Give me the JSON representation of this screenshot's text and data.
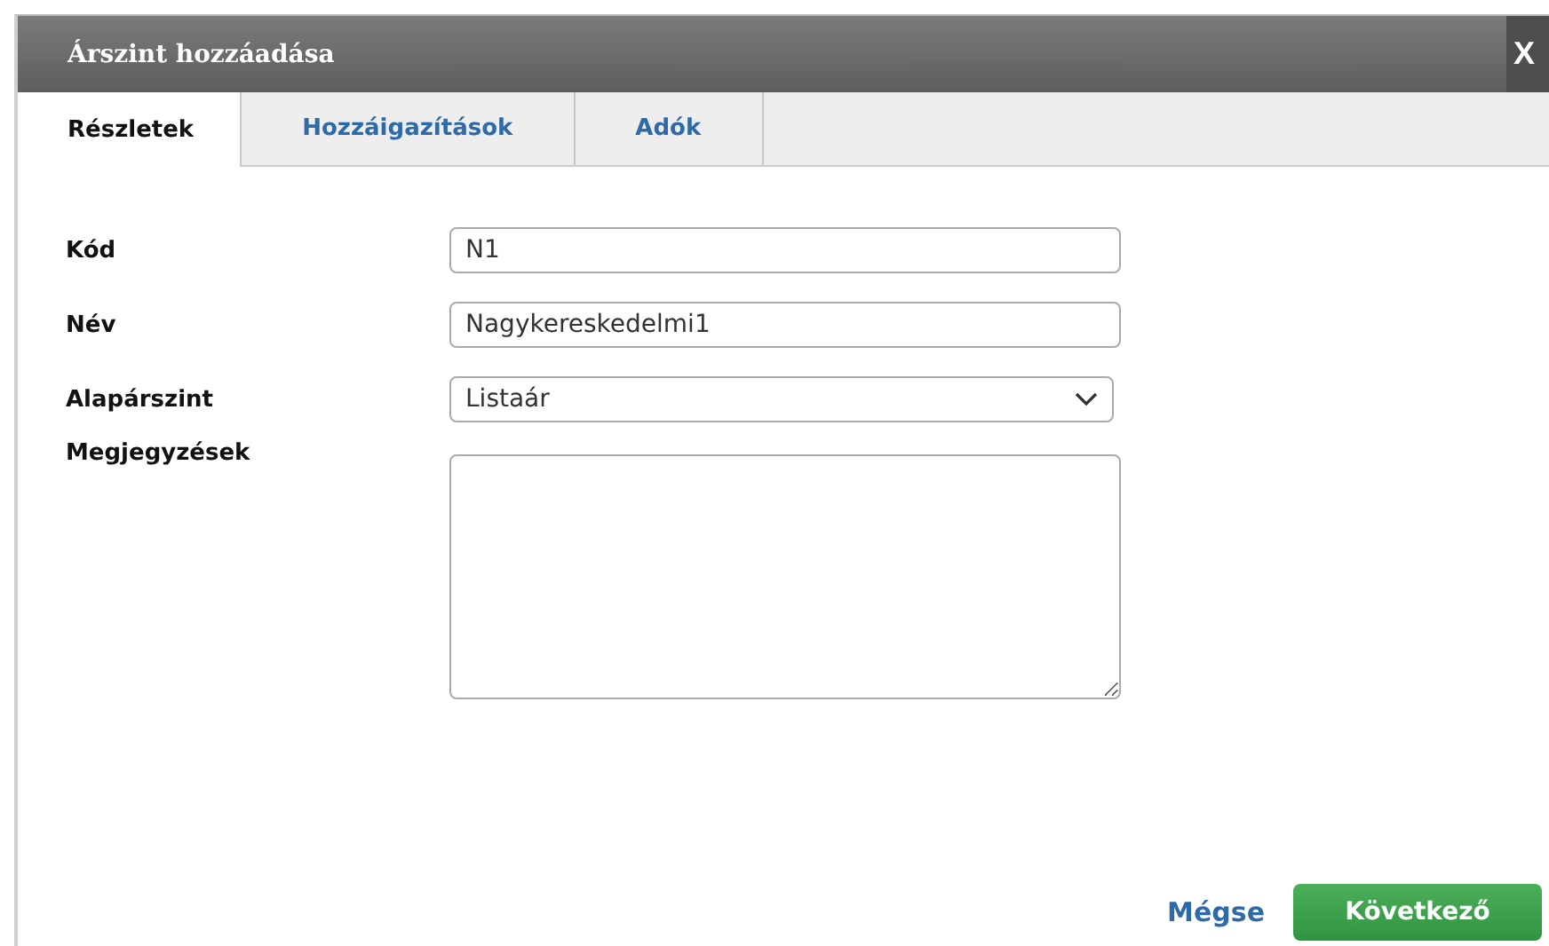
{
  "window": {
    "title": "Árszint hozzáadása",
    "close": "X"
  },
  "tabs": [
    {
      "label": "Részletek",
      "selected": true
    },
    {
      "label": "Hozzáigazítások",
      "selected": false
    },
    {
      "label": "Adók",
      "selected": false
    }
  ],
  "form": {
    "fields": [
      {
        "kind": "text",
        "label": "Kód",
        "value": "N1"
      },
      {
        "kind": "text",
        "label": "Név",
        "value": "Nagykereskedelmi1"
      },
      {
        "kind": "select",
        "label": "Alapárszint",
        "value": "Listaár"
      },
      {
        "kind": "textarea",
        "label": "Megjegyzések"
      }
    ]
  },
  "buttons": {
    "cancel": "Mégse",
    "next": "Következő"
  }
}
